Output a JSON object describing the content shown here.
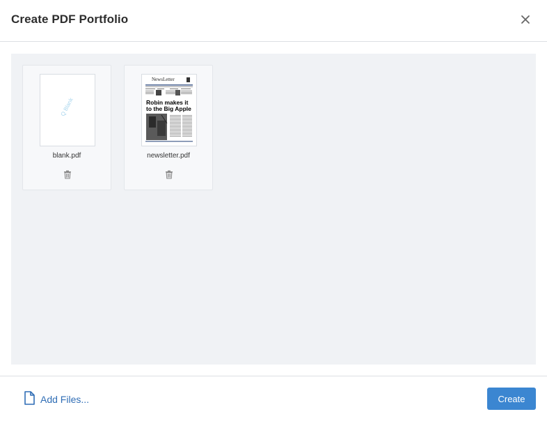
{
  "dialog": {
    "title": "Create PDF Portfolio",
    "close_icon": "close-icon"
  },
  "files": [
    {
      "name": "blank.pdf",
      "thumbnail_text": "Q Blank",
      "delete_icon": "trash-icon"
    },
    {
      "name": "newsletter.pdf",
      "thumbnail_title": "NewsLetter",
      "thumbnail_headline": "Robin makes it to the Big Apple",
      "delete_icon": "trash-icon"
    }
  ],
  "footer": {
    "add_files_label": "Add Files...",
    "add_files_icon": "file-icon",
    "create_label": "Create"
  },
  "colors": {
    "accent": "#3b86d1",
    "link": "#2f6db5",
    "content_bg": "#f0f2f5"
  }
}
